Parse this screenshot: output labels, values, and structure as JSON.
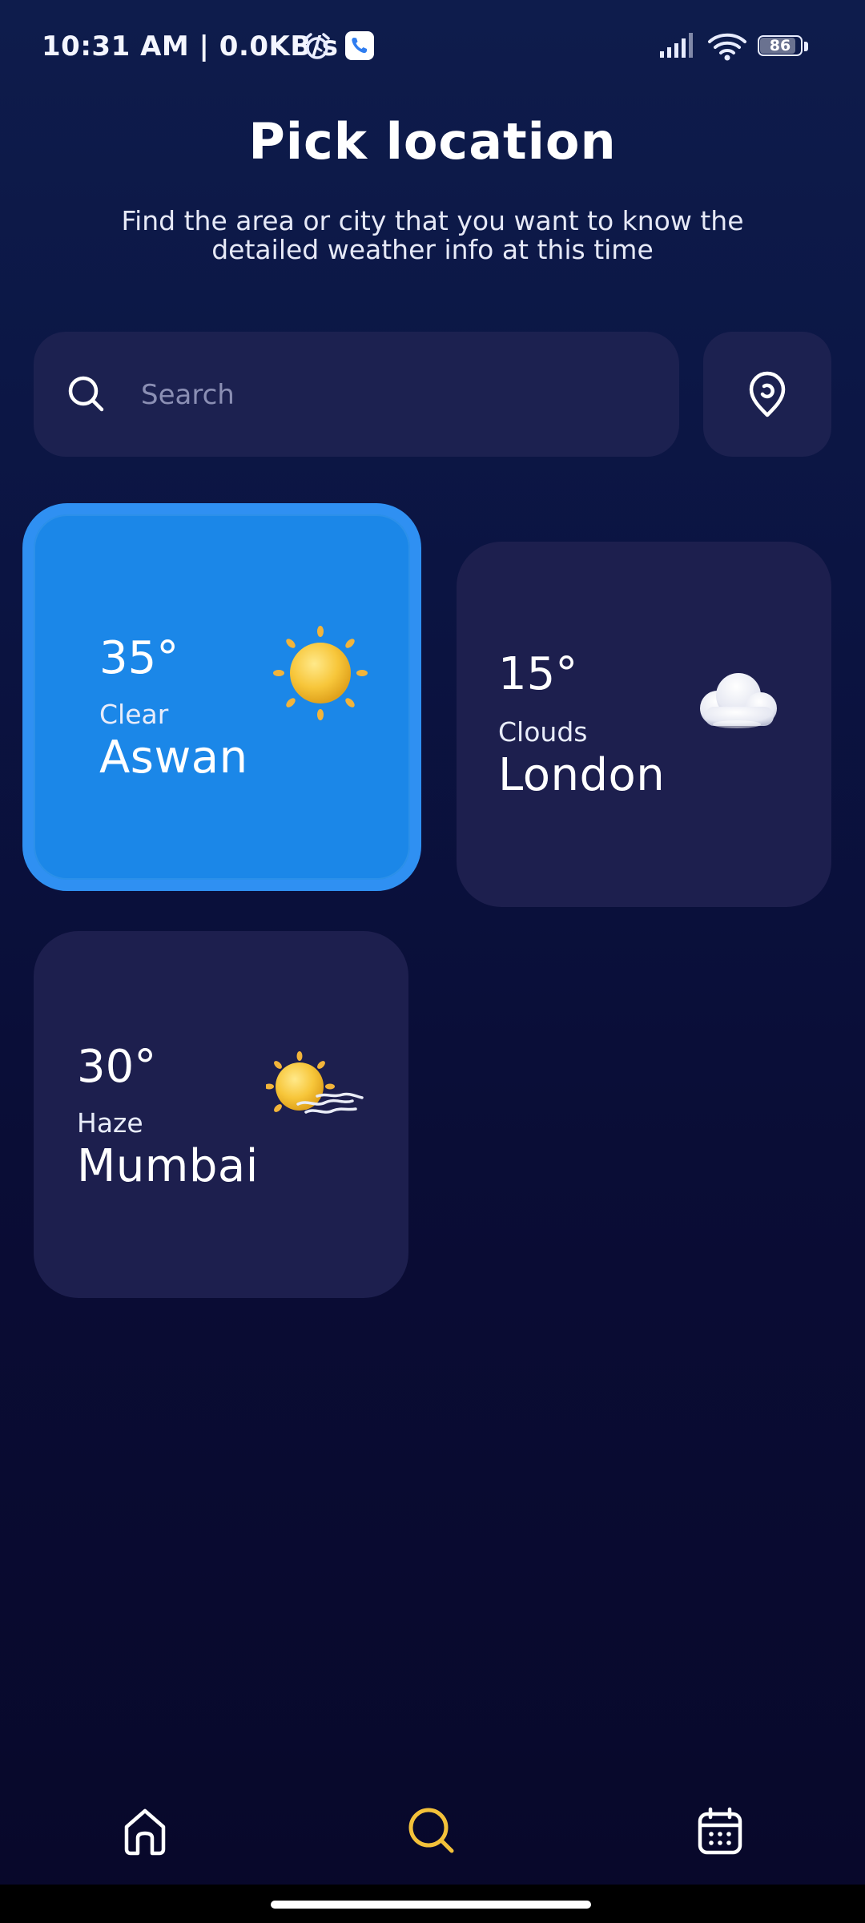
{
  "status_bar": {
    "time": "10:31 AM | 0.0KB/s",
    "battery": "86",
    "icons": [
      "alarm-icon",
      "phone-app-icon",
      "signal-icon",
      "wifi-icon",
      "battery-icon"
    ]
  },
  "header": {
    "title": "Pick location",
    "subtitle": "Find the area or city that you want to know the detailed weather info at this time"
  },
  "search": {
    "placeholder": "Search",
    "value": "",
    "icon": "search-icon",
    "location_icon": "location-pin-icon"
  },
  "cards": [
    {
      "temp": "35°",
      "condition": "Clear",
      "city": "Aswan",
      "icon": "sun-icon",
      "selected": true
    },
    {
      "temp": "15°",
      "condition": "Clouds",
      "city": "London",
      "icon": "cloud-icon",
      "selected": false
    },
    {
      "temp": "30°",
      "condition": "Haze",
      "city": "Mumbai",
      "icon": "haze-icon",
      "selected": false
    }
  ],
  "bottom_nav": {
    "items": [
      {
        "icon": "home-icon",
        "active": false
      },
      {
        "icon": "search-icon",
        "active": true
      },
      {
        "icon": "calendar-icon",
        "active": false
      }
    ]
  },
  "colors": {
    "background": "#0b1442",
    "card": "#1d1f4e",
    "selected_card": "#1b87e8",
    "active_nav": "#f3c13a",
    "text": "#ffffff"
  }
}
